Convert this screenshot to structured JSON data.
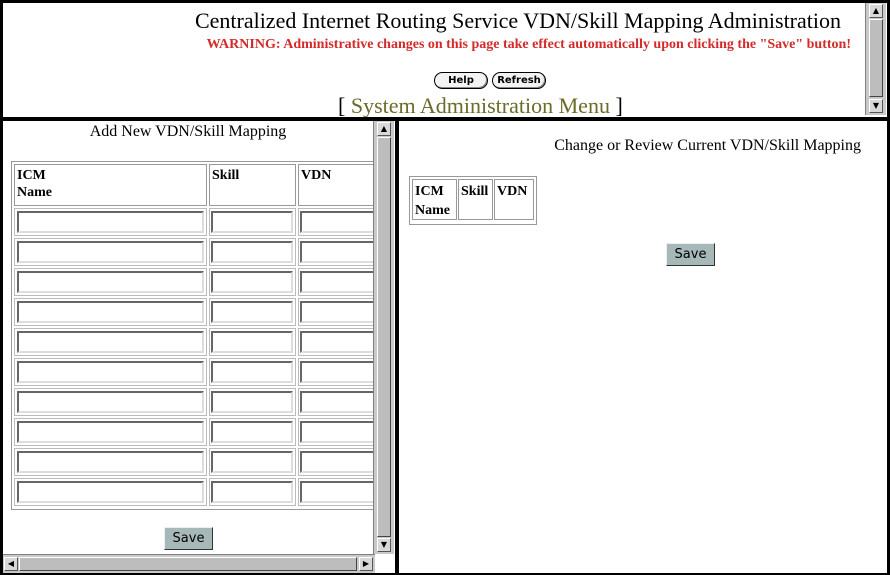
{
  "header": {
    "title": "Centralized Internet Routing Service VDN/Skill Mapping Administration",
    "warning": "WARNING: Administrative changes on this page take effect automatically upon clicking the \"Save\" button!",
    "help_label": "Help",
    "refresh_label": "Refresh",
    "menu_open": "[",
    "menu_link": "System Administration Menu",
    "menu_close": "]"
  },
  "add_panel": {
    "title": "Add New VDN/Skill Mapping",
    "columns": [
      "ICM Name",
      "Skill",
      "VDN"
    ],
    "col0_line1": "ICM",
    "col0_line2": "Name",
    "row_count": 10,
    "save_label": "Save"
  },
  "review_panel": {
    "title": "Change or Review Current VDN/Skill Mapping",
    "col0_line1": "ICM",
    "col0_line2": "Name",
    "col1": "Skill",
    "col2": "VDN",
    "save_label": "Save"
  },
  "colors": {
    "warning": "#d42a2a",
    "menu_link": "#6b6b2a",
    "button_bg": "#a6b8b8"
  }
}
